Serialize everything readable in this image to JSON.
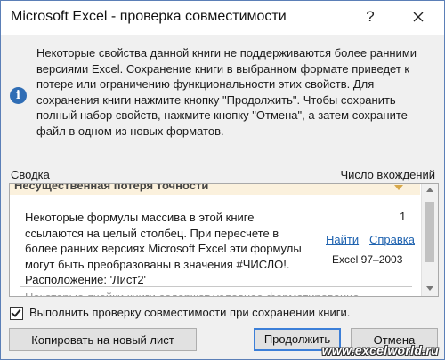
{
  "window": {
    "title": "Microsoft Excel - проверка совместимости",
    "help_label": "?",
    "close_icon": "close-icon"
  },
  "message": {
    "icon": "info-icon",
    "icon_glyph": "i",
    "text": "Некоторые свойства данной книги не поддерживаются более ранними версиями Excel. Сохранение книги в выбранном формате приведет к потере или ограничению функциональности этих свойств. Для сохранения книги нажмите кнопку \"Продолжить\". Чтобы сохранить полный набор свойств, нажмите кнопку \"Отмена\", а затем сохраните файл в одном из новых форматов."
  },
  "list": {
    "header_summary": "Сводка",
    "header_count": "Число вхождений",
    "group_title": "Несущественная потеря точности",
    "items": [
      {
        "description": "Некоторые формулы массива в этой книге ссылаются на целый столбец. При пересчете в более ранних версиях Microsoft Excel эти формулы могут быть преобразованы в значения #ЧИСЛО!.",
        "location": "Расположение: 'Лист2'",
        "count": "1",
        "find_label": "Найти",
        "help_label": "Справка",
        "version": "Excel 97–2003"
      }
    ],
    "next_item_peek": "Некоторые ячейки книги содержат условное форматирование"
  },
  "check_on_save": {
    "checked": true,
    "label": "Выполнить проверку совместимости при сохранении книги."
  },
  "buttons": {
    "copy": "Копировать на новый лист",
    "continue": "Продолжить",
    "cancel": "Отмена"
  },
  "watermark": "www.excelworld.ru",
  "colors": {
    "accent": "#3c7fd8",
    "link": "#1f63b0",
    "info_icon": "#2f6db5",
    "group_header_bg": "#fbf1dd"
  }
}
